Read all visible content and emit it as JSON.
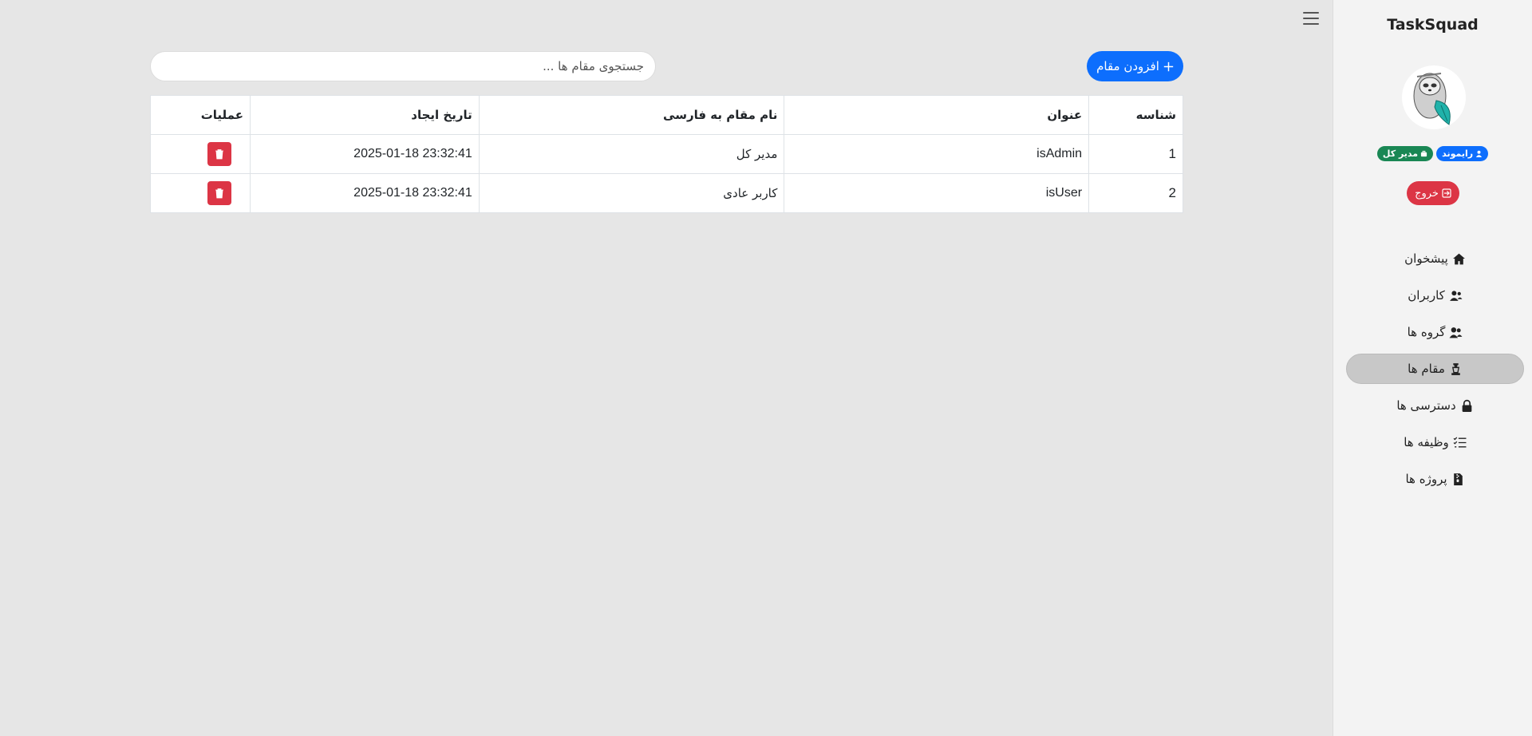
{
  "sidebar": {
    "brand": "TaskSquad",
    "user_badge": "رایموند",
    "role_badge": "مدیر کل",
    "logout_label": "خروج",
    "items": [
      {
        "label": "پیشخوان",
        "icon": "house-icon",
        "active": false
      },
      {
        "label": "کاربران",
        "icon": "users-icon",
        "active": false
      },
      {
        "label": "گروه ها",
        "icon": "user-group-icon",
        "active": false
      },
      {
        "label": "مقام ها",
        "icon": "chess-piece-icon",
        "active": true
      },
      {
        "label": "دسترسی ها",
        "icon": "lock-icon",
        "active": false
      },
      {
        "label": "وظیفه ها",
        "icon": "list-check-icon",
        "active": false
      },
      {
        "label": "پروژه ها",
        "icon": "file-zipper-icon",
        "active": false
      }
    ]
  },
  "toolbar": {
    "add_label": "افزودن مقام",
    "search_placeholder": "جستجوی مقام ها ..."
  },
  "table": {
    "headers": [
      "شناسه",
      "عنوان",
      "نام مقام به فارسی",
      "تاریخ ایجاد",
      "عملیات"
    ],
    "rows": [
      {
        "id": "1",
        "title": "isAdmin",
        "name_fa": "مدیر کل",
        "created": "2025-01-18 23:32:41"
      },
      {
        "id": "2",
        "title": "isUser",
        "name_fa": "کاربر عادی",
        "created": "2025-01-18 23:32:41"
      }
    ]
  },
  "colors": {
    "primary": "#0d6efd",
    "danger": "#dc3545",
    "success": "#198754",
    "background": "#e6e6e6",
    "sidebar": "#f3f3f3"
  }
}
